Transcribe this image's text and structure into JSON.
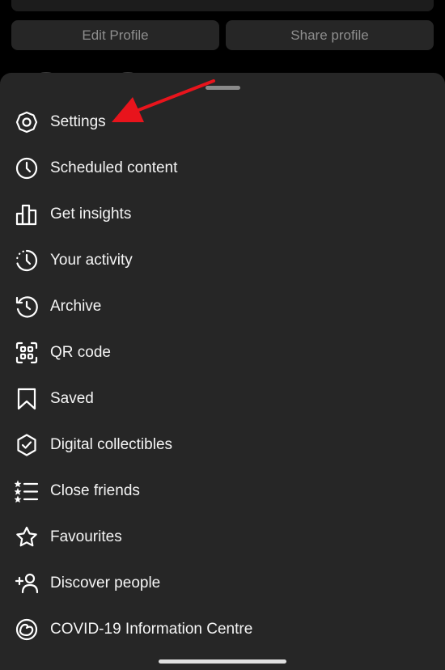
{
  "profile": {
    "edit_label": "Edit Profile",
    "share_label": "Share profile"
  },
  "menu": {
    "items": [
      {
        "label": "Settings",
        "icon": "settings-gear-icon"
      },
      {
        "label": "Scheduled content",
        "icon": "clock-icon"
      },
      {
        "label": "Get insights",
        "icon": "bar-chart-icon"
      },
      {
        "label": "Your activity",
        "icon": "activity-clock-icon"
      },
      {
        "label": "Archive",
        "icon": "archive-history-icon"
      },
      {
        "label": "QR code",
        "icon": "qr-code-icon"
      },
      {
        "label": "Saved",
        "icon": "bookmark-icon"
      },
      {
        "label": "Digital collectibles",
        "icon": "shield-check-icon"
      },
      {
        "label": "Close friends",
        "icon": "star-list-icon"
      },
      {
        "label": "Favourites",
        "icon": "star-icon"
      },
      {
        "label": "Discover people",
        "icon": "add-person-icon"
      },
      {
        "label": "COVID-19 Information Centre",
        "icon": "covid-info-icon"
      }
    ]
  },
  "colors": {
    "sheet_background": "#262626",
    "page_background": "#000000",
    "arrow": "#e8141c"
  }
}
